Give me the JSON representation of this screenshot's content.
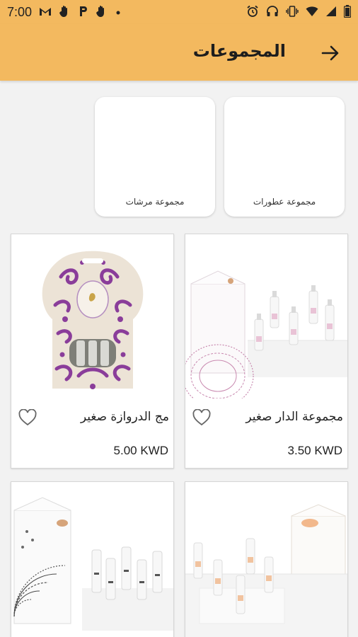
{
  "status_bar": {
    "time": "7:00",
    "icons_left": [
      "gmail-icon",
      "hand-icon",
      "parking-icon",
      "hand-icon",
      "dot-icon"
    ],
    "icons_right": [
      "alarm-icon",
      "headset-icon",
      "vibrate-icon",
      "wifi-icon",
      "signal-icon",
      "battery-icon"
    ]
  },
  "app_bar": {
    "title": "المجموعات",
    "back_icon": "arrow-icon"
  },
  "categories": [
    {
      "label": "مجموعة عطورات"
    },
    {
      "label": "مجموعة مرشات"
    }
  ],
  "products": [
    {
      "name": "مجموعة الدار صغير",
      "price": "3.50 KWD"
    },
    {
      "name": "مج الدروازة صغير",
      "price": "5.00 KWD"
    },
    {
      "name": "",
      "price": ""
    },
    {
      "name": "",
      "price": ""
    }
  ],
  "colors": {
    "header": "#f3b95f",
    "background": "#f2f2f2",
    "purple_print": "#8a3d9a",
    "peach_print": "#f2b88c"
  }
}
